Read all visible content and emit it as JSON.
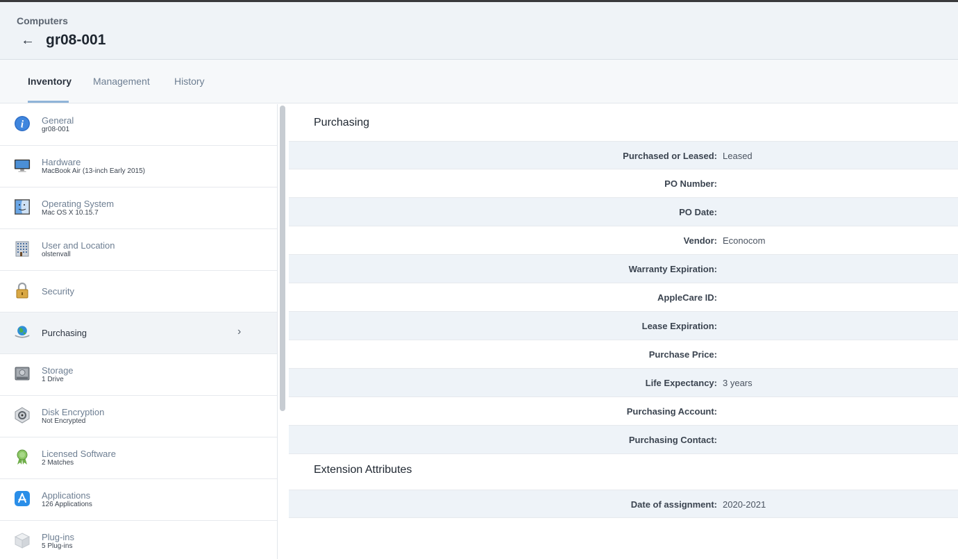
{
  "header": {
    "breadcrumb": "Computers",
    "back_icon": "arrow-left-icon",
    "title": "gr08-001"
  },
  "tabs": [
    {
      "label": "Inventory",
      "active": true
    },
    {
      "label": "Management",
      "active": false
    },
    {
      "label": "History",
      "active": false
    }
  ],
  "sidebar": {
    "items": [
      {
        "label": "General",
        "sub": "gr08-001",
        "icon": "info-icon"
      },
      {
        "label": "Hardware",
        "sub": "MacBook Air (13-inch Early 2015)",
        "icon": "monitor-icon"
      },
      {
        "label": "Operating System",
        "sub": "Mac OS X 10.15.7",
        "icon": "finder-icon"
      },
      {
        "label": "User and Location",
        "sub": "olstenvall",
        "icon": "building-icon"
      },
      {
        "label": "Security",
        "sub": "",
        "icon": "padlock-icon"
      },
      {
        "label": "Purchasing",
        "sub": "",
        "icon": "globe-icon",
        "active": true
      },
      {
        "label": "Storage",
        "sub": "1 Drive",
        "icon": "hard-drive-icon"
      },
      {
        "label": "Disk Encryption",
        "sub": "Not Encrypted",
        "icon": "filevault-icon"
      },
      {
        "label": "Licensed Software",
        "sub": "2 Matches",
        "icon": "ribbon-icon"
      },
      {
        "label": "Applications",
        "sub": "126 Applications",
        "icon": "app-store-icon"
      },
      {
        "label": "Plug-ins",
        "sub": "5 Plug-ins",
        "icon": "plugin-box-icon"
      }
    ]
  },
  "purchasing": {
    "title": "Purchasing",
    "rows": [
      {
        "label": "Purchased or Leased:",
        "value": "Leased"
      },
      {
        "label": "PO Number:",
        "value": ""
      },
      {
        "label": "PO Date:",
        "value": ""
      },
      {
        "label": "Vendor:",
        "value": "Econocom"
      },
      {
        "label": "Warranty Expiration:",
        "value": ""
      },
      {
        "label": "AppleCare ID:",
        "value": ""
      },
      {
        "label": "Lease Expiration:",
        "value": ""
      },
      {
        "label": "Purchase Price:",
        "value": ""
      },
      {
        "label": "Life Expectancy:",
        "value": "3 years"
      },
      {
        "label": "Purchasing Account:",
        "value": ""
      },
      {
        "label": "Purchasing Contact:",
        "value": ""
      }
    ]
  },
  "extension_attributes": {
    "title": "Extension Attributes",
    "rows": [
      {
        "label": "Date of assignment:",
        "value": "2020-2021"
      }
    ]
  }
}
